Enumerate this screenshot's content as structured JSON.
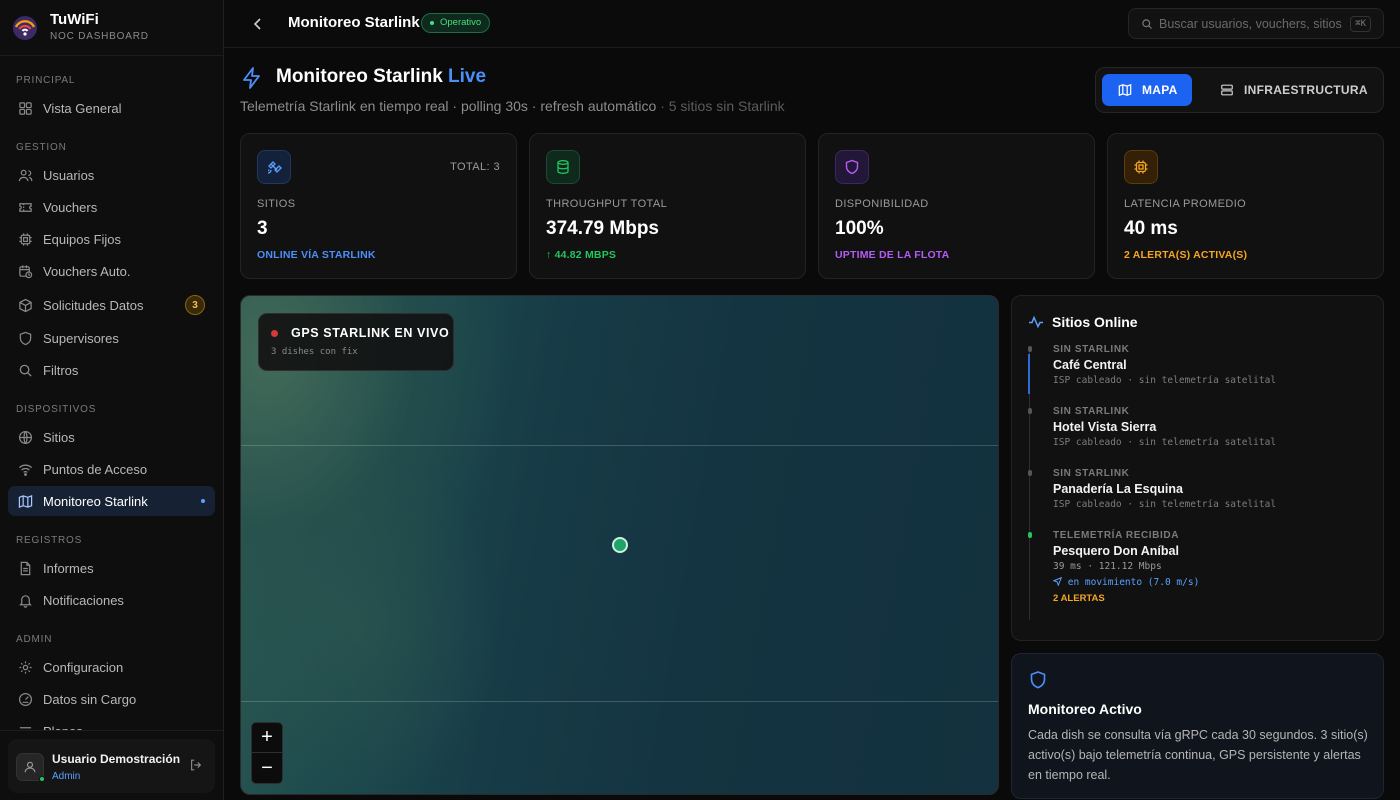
{
  "brand": {
    "name": "TuWiFi",
    "subtitle": "NOC DASHBOARD"
  },
  "sidebar": {
    "sections": [
      {
        "title": "PRINCIPAL"
      },
      {
        "title": "GESTION"
      },
      {
        "title": "DISPOSITIVOS"
      },
      {
        "title": "REGISTROS"
      },
      {
        "title": "ADMIN"
      }
    ],
    "items": [
      {
        "label": "Vista General",
        "icon": "grid-icon"
      },
      {
        "label": "Usuarios",
        "icon": "users-icon"
      },
      {
        "label": "Vouchers",
        "icon": "ticket-icon"
      },
      {
        "label": "Equipos Fijos",
        "icon": "chip-icon"
      },
      {
        "label": "Vouchers Auto.",
        "icon": "clock-calendar-icon"
      },
      {
        "label": "Solicitudes Datos",
        "icon": "package-icon",
        "badge": "3"
      },
      {
        "label": "Supervisores",
        "icon": "shield-icon"
      },
      {
        "label": "Filtros",
        "icon": "search-icon"
      },
      {
        "label": "Sitios",
        "icon": "globe-icon"
      },
      {
        "label": "Puntos de Acceso",
        "icon": "wifi-icon"
      },
      {
        "label": "Monitoreo Starlink",
        "icon": "map-icon",
        "active": true
      },
      {
        "label": "Informes",
        "icon": "document-icon"
      },
      {
        "label": "Notificaciones",
        "icon": "bell-icon"
      },
      {
        "label": "Configuracion",
        "icon": "gear-icon"
      },
      {
        "label": "Datos sin Cargo",
        "icon": "gauge-icon"
      },
      {
        "label": "Planes",
        "icon": "list-icon"
      }
    ]
  },
  "user": {
    "name": "Usuario Demostración",
    "role": "Admin"
  },
  "topbar": {
    "title": "Monitoreo Starlink",
    "status": "Operativo",
    "search_placeholder": "Buscar usuarios, vouchers, sitios...",
    "shortcut": "⌘K"
  },
  "header": {
    "title": "Monitoreo Starlink",
    "live": "Live",
    "subtitle": "Telemetría Starlink en tiempo real · polling 30s · refresh automático",
    "subtitle_extra": "· 5 sitios sin Starlink"
  },
  "view_toggle": {
    "map_label": "MAPA",
    "infra_label": "INFRAESTRUCTURA",
    "selected": "MAPA"
  },
  "stats": [
    {
      "label": "SITIOS",
      "value": "3",
      "meta": "TOTAL: 3",
      "foot": "ONLINE VÍA STARLINK",
      "color": "#4b8ff7",
      "icon": "satellite-icon"
    },
    {
      "label": "THROUGHPUT TOTAL",
      "value": "374.79 Mbps",
      "foot": "↑ 44.82 MBPS",
      "color": "#22c55e",
      "icon": "database-icon"
    },
    {
      "label": "DISPONIBILIDAD",
      "value": "100%",
      "foot": "UPTIME DE LA FLOTA",
      "color": "#b45cf6",
      "icon": "shield-icon"
    },
    {
      "label": "LATENCIA PROMEDIO",
      "value": "40 ms",
      "foot": "2 ALERTA(S) ACTIVA(S)",
      "color": "#f5a524",
      "icon": "cpu-icon"
    }
  ],
  "map": {
    "overlay_title": "GPS STARLINK EN VIVO",
    "overlay_sub": "3 dishes con fix",
    "zoom_in": "+",
    "zoom_out": "−"
  },
  "sites_panel": {
    "title": "Sitios Online",
    "items": [
      {
        "label": "SIN STARLINK",
        "name": "Café Central",
        "desc": "ISP cableado · sin telemetría satelital"
      },
      {
        "label": "SIN STARLINK",
        "name": "Hotel Vista Sierra",
        "desc": "ISP cableado · sin telemetría satelital"
      },
      {
        "label": "SIN STARLINK",
        "name": "Panadería La Esquina",
        "desc": "ISP cableado · sin telemetría satelital"
      },
      {
        "label": "TELEMETRÍA RECIBIDA",
        "name": "Pesquero Don Aníbal",
        "desc": "39 ms · 121.12 Mbps",
        "movement": "en movimiento (7.0 m/s)",
        "alerts": "2 ALERTAS"
      }
    ]
  },
  "active_panel": {
    "title": "Monitoreo Activo",
    "text": "Cada dish se consulta vía gRPC cada 30 segundos. 3 sitio(s) activo(s) bajo telemetría continua, GPS persistente y alertas en tiempo real."
  },
  "colors": {
    "accent": "#1d63f2",
    "success": "#22c55e",
    "warning": "#f5a524",
    "purple": "#b45cf6"
  }
}
